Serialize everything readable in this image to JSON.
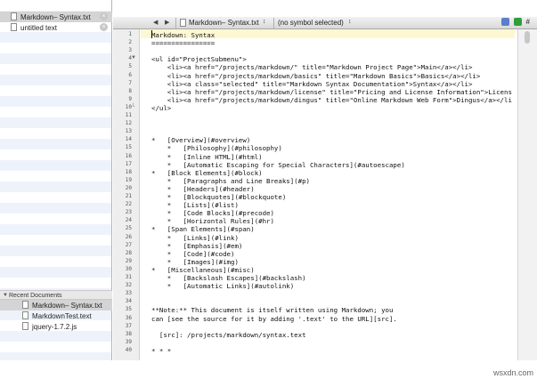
{
  "sidebar": {
    "open_files": [
      {
        "name": "Markdown– Syntax.txt",
        "active": true
      },
      {
        "name": "untitled text",
        "active": false
      }
    ],
    "recent_header": "Recent Documents",
    "recent_files": [
      {
        "name": "Markdown– Syntax.txt",
        "active": true
      },
      {
        "name": "MarkdownTest.text",
        "active": false
      },
      {
        "name": "jquery-1.7.2.js",
        "active": false
      }
    ],
    "close_glyph": "×"
  },
  "navbar": {
    "back": "◀",
    "forward": "▶",
    "file": "Markdown– Syntax.txt",
    "symbol": "(no symbol selected)",
    "arrows": "↕",
    "hash": "#"
  },
  "lines": [
    "Markdown: Syntax",
    "================",
    "",
    "<ul id=\"ProjectSubmenu\">",
    "    <li><a href=\"/projects/markdown/\" title=\"Markdown Project Page\">Main</a></li>",
    "    <li><a href=\"/projects/markdown/basics\" title=\"Markdown Basics\">Basics</a></li>",
    "    <li><a class=\"selected\" title=\"Markdown Syntax Documentation\">Syntax</a></li>",
    "    <li><a href=\"/projects/markdown/license\" title=\"Pricing and License Information\">Licens",
    "    <li><a href=\"/projects/markdown/dingus\" title=\"Online Markdown Web Form\">Dingus</a></li",
    "</ul>",
    "",
    "",
    "",
    "*   [Overview](#overview)",
    "    *   [Philosophy](#philosophy)",
    "    *   [Inline HTML](#html)",
    "    *   [Automatic Escaping for Special Characters](#autoescape)",
    "*   [Block Elements](#block)",
    "    *   [Paragraphs and Line Breaks](#p)",
    "    *   [Headers](#header)",
    "    *   [Blockquotes](#blockquote)",
    "    *   [Lists](#list)",
    "    *   [Code Blocks](#precode)",
    "    *   [Horizontal Rules](#hr)",
    "*   [Span Elements](#span)",
    "    *   [Links](#link)",
    "    *   [Emphasis](#em)",
    "    *   [Code](#code)",
    "    *   [Images](#img)",
    "*   [Miscellaneous](#misc)",
    "    *   [Backslash Escapes](#backslash)",
    "    *   [Automatic Links](#autolink)",
    "",
    "",
    "**Note:** This document is itself written using Markdown; you",
    "can [see the source for it by adding '.text' to the URL][src].",
    "",
    "  [src]: /projects/markdown/syntax.text",
    "",
    "* * *",
    ""
  ],
  "line_numbers": [
    "1",
    "2",
    "3",
    "4",
    "5",
    "6",
    "7",
    "8",
    "9",
    "10",
    "11",
    "12",
    "13",
    "14",
    "15",
    "16",
    "17",
    "18",
    "19",
    "20",
    "21",
    "22",
    "23",
    "24",
    "25",
    "26",
    "27",
    "28",
    "29",
    "30",
    "31",
    "32",
    "33",
    "34",
    "35",
    "36",
    "37",
    "38",
    "39",
    "40"
  ],
  "fold_marks": {
    "open": "▼",
    "close": "└"
  },
  "colors": {
    "accent_green": "#2f9e3a",
    "accent_blue": "#5b7fc9"
  },
  "watermark": "wsxdn.com"
}
